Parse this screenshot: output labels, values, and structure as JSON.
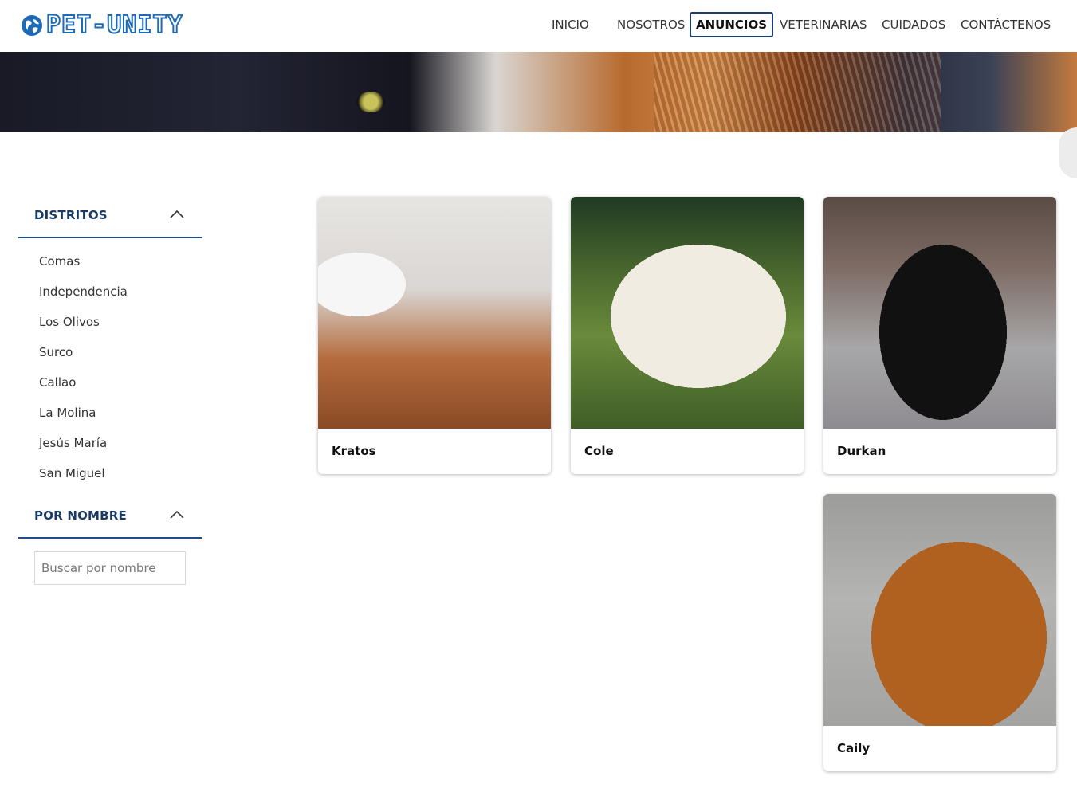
{
  "header": {
    "brand": "PET-UNITY",
    "nav": [
      {
        "label": "INICIO"
      },
      {
        "label": "NOSOTROS"
      },
      {
        "label": "ANUNCIOS",
        "active": true
      },
      {
        "label": "VETERINARIAS"
      },
      {
        "label": "CUIDADOS"
      },
      {
        "label": "CONTÁCTENOS"
      }
    ]
  },
  "sidebar": {
    "districts": {
      "title": "DISTRITOS",
      "items": [
        "Comas",
        "Independencia",
        "Los Olivos",
        "Surco",
        "Callao",
        "La Molina",
        "Jesús María",
        "San Miguel"
      ]
    },
    "by_name": {
      "title": "POR NOMBRE",
      "search_placeholder": "Buscar por nombre"
    }
  },
  "pets": [
    {
      "name": "Kratos"
    },
    {
      "name": "Cole"
    },
    {
      "name": "Durkan"
    },
    {
      "name": "Caily"
    }
  ],
  "colors": {
    "nav_active_border": "#1a3e6e",
    "filter_accent": "#1f4e8c",
    "filter_title": "#1a3a66",
    "brand": "#1d6bb8"
  }
}
